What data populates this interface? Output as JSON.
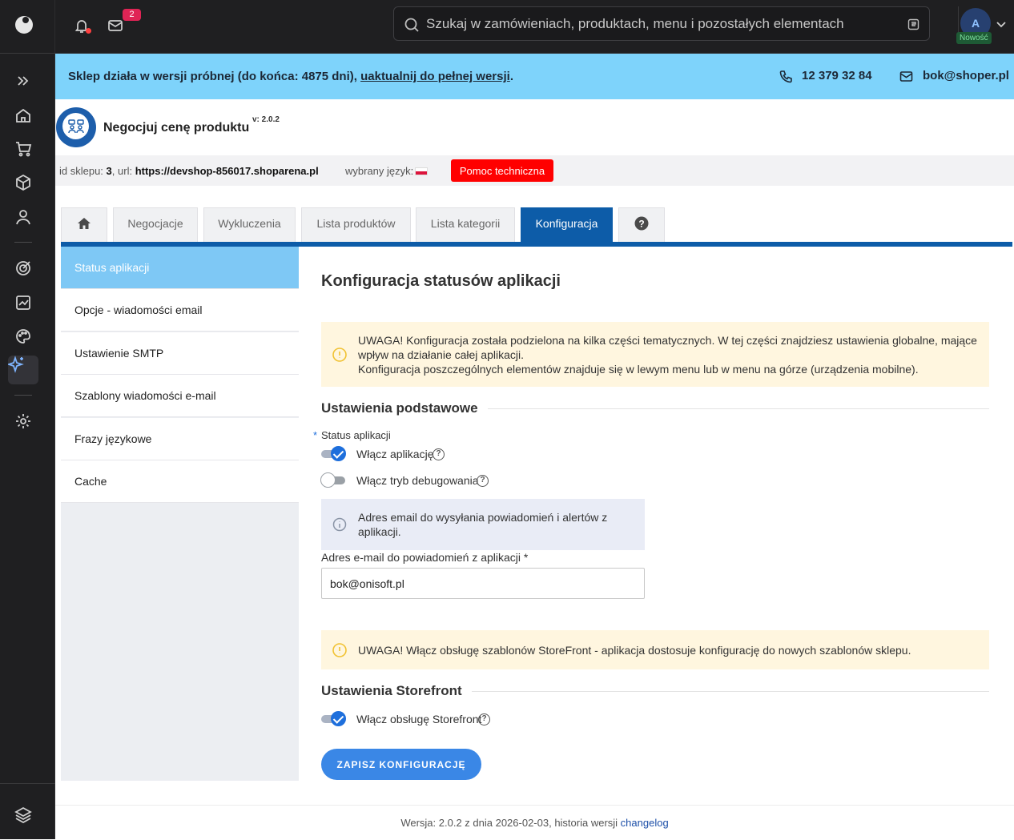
{
  "topbar": {
    "mail_badge": "2",
    "search_placeholder": "Szukaj w zamówieniach, produktach, menu i pozostałych elementach",
    "avatar_initial": "A",
    "new_badge": "Nowość"
  },
  "banner": {
    "message": "Sklep działa w wersji próbnej (do końca: 4875 dni), ",
    "upgrade_link": "uaktualnij do pełnej wersji",
    "message_end": ".",
    "phone": "12 379 32 84",
    "email": "bok@shoper.pl"
  },
  "app": {
    "title": "Negocjuj cenę produktu",
    "version": "v: 2.0.2"
  },
  "info_strip": {
    "shop_id_label": "id sklepu: ",
    "shop_id": "3",
    "url_label": ", url: ",
    "url": "https://devshop-856017.shoparena.pl",
    "lang_label": "wybrany język:",
    "help_button": "Pomoc techniczna"
  },
  "tabs": [
    {
      "label": "Negocjacje"
    },
    {
      "label": "Wykluczenia"
    },
    {
      "label": "Lista produktów"
    },
    {
      "label": "Lista kategorii"
    },
    {
      "label": "Konfiguracja"
    }
  ],
  "sidebar": {
    "items": [
      {
        "label": "Status aplikacji"
      },
      {
        "label": "Opcje - wiadomości email"
      },
      {
        "label": "Ustawienie SMTP"
      },
      {
        "label": "Szablony wiadomości e-mail"
      },
      {
        "label": "Frazy językowe"
      },
      {
        "label": "Cache"
      }
    ]
  },
  "main": {
    "title": "Konfiguracja statusów aplikacji",
    "alert1_line1": "UWAGA! Konfiguracja została podzielona na kilka części tematycznych. W tej części znajdziesz ustawienia globalne, mające wpływ na działanie całej aplikacji.",
    "alert1_line2": "Konfiguracja poszczególnych elementów znajduje się w lewym menu lub w menu na górze (urządzenia mobilne).",
    "section_basic": "Ustawienia podstawowe",
    "status_label": "Status aplikacji",
    "toggle_enable_app": "Włącz aplikację",
    "toggle_enable_app_state": true,
    "toggle_debug": "Włącz tryb debugowania",
    "toggle_debug_state": false,
    "info_email": "Adres email do wysyłania powiadomień i alertów z aplikacji.",
    "email_label": "Adres e-mail do powiadomień z aplikacji *",
    "email_value": "bok@onisoft.pl",
    "alert2": "UWAGA! Włącz obsługę szablonów StoreFront - aplikacja dostosuje konfigurację do nowych szablonów sklepu.",
    "section_storefront": "Ustawienia Storefront",
    "toggle_storefront": "Włącz obsługę Storefront",
    "toggle_storefront_state": true,
    "save_button": "ZAPISZ KONFIGURACJĘ"
  },
  "footer": {
    "text": "Wersja: 2.0.2 z dnia 2026-02-03, historia wersji ",
    "link": "changelog"
  },
  "colors": {
    "accent": "#0d5ca8",
    "banner": "#7ed3fb",
    "sidebar_active": "#7ec8f5",
    "help_button": "#ff0000",
    "save_button": "#3a87e6"
  }
}
